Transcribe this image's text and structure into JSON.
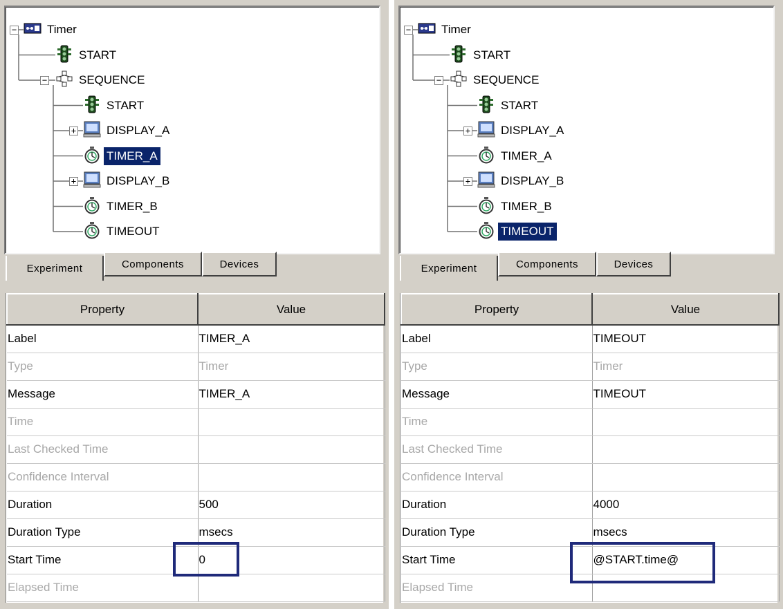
{
  "panels": [
    {
      "tree": {
        "root": "Timer",
        "nodes": [
          "START",
          "SEQUENCE",
          "START",
          "DISPLAY_A",
          "TIMER_A",
          "DISPLAY_B",
          "TIMER_B",
          "TIMEOUT"
        ]
      },
      "selected": "TIMER_A",
      "tabs": [
        "Experiment",
        "Components",
        "Devices"
      ],
      "active_tab": "Experiment",
      "table": {
        "headers": [
          "Property",
          "Value"
        ],
        "rows": [
          {
            "property": "Label",
            "value": "TIMER_A",
            "enabled": true
          },
          {
            "property": "Type",
            "value": "Timer",
            "enabled": false
          },
          {
            "property": "Message",
            "value": "TIMER_A",
            "enabled": true
          },
          {
            "property": "Time",
            "value": "",
            "enabled": false
          },
          {
            "property": "Last Checked Time",
            "value": "",
            "enabled": false
          },
          {
            "property": "Confidence Interval",
            "value": "",
            "enabled": false
          },
          {
            "property": "Duration",
            "value": "500",
            "enabled": true
          },
          {
            "property": "Duration Type",
            "value": "msecs",
            "enabled": true
          },
          {
            "property": "Start Time",
            "value": "0",
            "enabled": true
          },
          {
            "property": "Elapsed Time",
            "value": "",
            "enabled": false
          }
        ]
      },
      "highlight_color": "#1f2a7a"
    },
    {
      "tree": {
        "root": "Timer",
        "nodes": [
          "START",
          "SEQUENCE",
          "START",
          "DISPLAY_A",
          "TIMER_A",
          "DISPLAY_B",
          "TIMER_B",
          "TIMEOUT"
        ]
      },
      "selected": "TIMEOUT",
      "tabs": [
        "Experiment",
        "Components",
        "Devices"
      ],
      "active_tab": "Experiment",
      "table": {
        "headers": [
          "Property",
          "Value"
        ],
        "rows": [
          {
            "property": "Label",
            "value": "TIMEOUT",
            "enabled": true
          },
          {
            "property": "Type",
            "value": "Timer",
            "enabled": false
          },
          {
            "property": "Message",
            "value": "TIMEOUT",
            "enabled": true
          },
          {
            "property": "Time",
            "value": "",
            "enabled": false
          },
          {
            "property": "Last Checked Time",
            "value": "",
            "enabled": false
          },
          {
            "property": "Confidence Interval",
            "value": "",
            "enabled": false
          },
          {
            "property": "Duration",
            "value": "4000",
            "enabled": true
          },
          {
            "property": "Duration Type",
            "value": "msecs",
            "enabled": true
          },
          {
            "property": "Start Time",
            "value": "@START.time@",
            "enabled": true
          },
          {
            "property": "Elapsed Time",
            "value": "",
            "enabled": false
          }
        ]
      },
      "highlight_color": "#1f2a7a"
    }
  ],
  "colors": {
    "selection_bg": "#0a246a",
    "chrome": "#d4d0c8",
    "disabled_text": "#a8a8a8"
  },
  "icons": {
    "root": "experiment-icon",
    "START": "traffic-light-icon",
    "SEQUENCE": "sequence-icon",
    "DISPLAY_A": "monitor-icon",
    "DISPLAY_B": "monitor-icon",
    "TIMER_A": "stopwatch-icon",
    "TIMER_B": "stopwatch-icon",
    "TIMEOUT": "stopwatch-icon"
  }
}
